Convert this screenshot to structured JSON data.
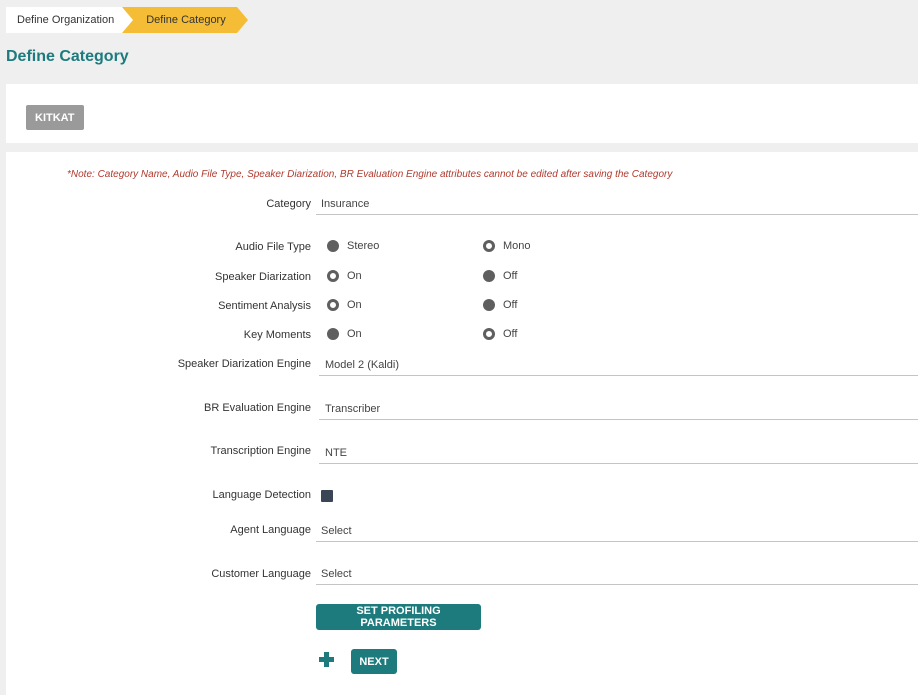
{
  "breadcrumb": {
    "items": [
      "Define Organization",
      "Define Category"
    ]
  },
  "page_title": "Define Category",
  "org_button": "KITKAT",
  "form": {
    "note": "*Note: Category Name, Audio File Type, Speaker Diarization, BR Evaluation Engine attributes cannot be edited after saving the Category",
    "category": {
      "label": "Category",
      "value": "Insurance"
    },
    "audio_file_type": {
      "label": "Audio File Type",
      "opt1": "Stereo",
      "opt2": "Mono",
      "selected": "Mono"
    },
    "speaker_diarization": {
      "label": "Speaker Diarization",
      "opt1": "On",
      "opt2": "Off",
      "selected": "On"
    },
    "sentiment_analysis": {
      "label": "Sentiment Analysis",
      "opt1": "On",
      "opt2": "Off",
      "selected": "On"
    },
    "key_moments": {
      "label": "Key Moments",
      "opt1": "On",
      "opt2": "Off",
      "selected": "Off"
    },
    "speaker_diarization_engine": {
      "label": "Speaker Diarization Engine",
      "value": "Model 2 (Kaldi)"
    },
    "br_evaluation_engine": {
      "label": "BR Evaluation Engine",
      "value": "Transcriber"
    },
    "transcription_engine": {
      "label": "Transcription Engine",
      "value": "NTE"
    },
    "language_detection": {
      "label": "Language Detection",
      "checked": true
    },
    "agent_language": {
      "label": "Agent Language",
      "value": "Select"
    },
    "customer_language": {
      "label": "Customer Language",
      "value": "Select"
    }
  },
  "buttons": {
    "set_profiling": "SET PROFILING PARAMETERS",
    "next": "NEXT"
  },
  "colors": {
    "accent": "#1d7b7e",
    "breadcrumb_active": "#f4bd35",
    "note": "#b03a2e",
    "radio": "#5f5f5f"
  }
}
